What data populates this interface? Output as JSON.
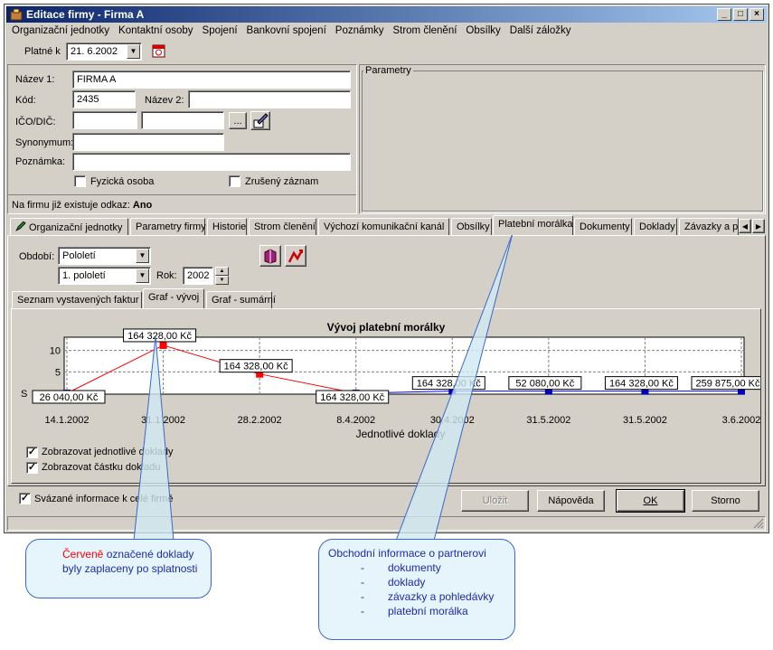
{
  "window": {
    "title": "Editace firmy - Firma A"
  },
  "menu": [
    "Organizační jednotky",
    "Kontaktní osoby",
    "Spojení",
    "Bankovní spojení",
    "Poznámky",
    "Strom členění",
    "Obsílky",
    "Další záložky"
  ],
  "valid_from": {
    "label": "Platné k",
    "value": "21. 6.2002"
  },
  "form": {
    "nazev1_label": "Název 1:",
    "nazev1": "FIRMA A",
    "kod_label": "Kód:",
    "kod": "2435",
    "nazev2_label": "Název 2:",
    "nazev2": "",
    "ico_label": "IČO/DIČ:",
    "ico": "",
    "dic": "",
    "ellipsis": "...",
    "synonymum_label": "Synonymum:",
    "synonymum": "",
    "poznamka_label": "Poznámka:",
    "poznamka": "",
    "fyzicka_osoba": "Fyzická osoba",
    "zruseny_zaznam": "Zrušený záznam",
    "existuje_label": "Na firmu již existuje odkaz:",
    "existuje_value": "Ano"
  },
  "parametry": {
    "title": "Parametry"
  },
  "tabs": [
    "Organizační jednotky",
    "Parametry firmy",
    "Historie",
    "Strom členění",
    "Výchozí komunikační kanál",
    "Obsílky",
    "Platební morálka",
    "Dokumenty",
    "Doklady",
    "Závazky a p"
  ],
  "active_tab": "Platební morálka",
  "filter": {
    "obdobi_label": "Období:",
    "obdobi": "Pololetí",
    "pololeti": "1. pololetí",
    "rok_label": "Rok:",
    "rok": "2002"
  },
  "subtabs": [
    "Seznam vystavených faktur",
    "Graf - vývoj",
    "Graf - sumární"
  ],
  "active_subtab": "Graf - vývoj",
  "chart_data": {
    "type": "line",
    "title": "Vývoj platební morálky",
    "xlabel": "Jednotlivé doklady",
    "ylabel": "",
    "y_tick_labels": [
      "10",
      "5"
    ],
    "y_axis_partial_label": "S",
    "categories": [
      "14.1.2002",
      "31.1.2002",
      "28.2.2002",
      "8.4.2002",
      "30.4.2002",
      "31.5.2002",
      "31.5.2002",
      "3.6.2002"
    ],
    "values": [
      0,
      11.2,
      4.5,
      0,
      0.5,
      0.5,
      0.5,
      0.5
    ],
    "late": [
      false,
      true,
      true,
      false,
      false,
      false,
      false,
      false
    ],
    "data_labels": [
      "26 040,00 Kč",
      "164 328,00 Kč",
      "164 328,00 Kč",
      "164 328,00 Kč",
      "164 328,00 Kč",
      "52 080,00 Kč",
      "164 328,00 Kč",
      "259 875,00 Kč"
    ],
    "colors": {
      "late_line": "#ff0000",
      "ontime_line": "#0000ff",
      "late_marker": "#ff0000",
      "ontime_marker": "#0000c0"
    },
    "grid": true
  },
  "options": {
    "show_documents": "Zobrazovat jednotlivé doklady",
    "show_amount": "Zobrazovat částku dokladu"
  },
  "footer": {
    "linked_info": "Svázané informace k celé firmě",
    "save": "Uložit",
    "help": "Nápověda",
    "ok": "OK",
    "cancel": "Storno"
  },
  "callouts": {
    "red": {
      "highlight": "Červeně",
      "text": " označené doklady byly zaplaceny po splatnosti"
    },
    "info": {
      "title": "Obchodní informace o partnerovi",
      "items": [
        "dokumenty",
        "doklady",
        "závazky a pohledávky",
        "platební morálka"
      ]
    }
  }
}
